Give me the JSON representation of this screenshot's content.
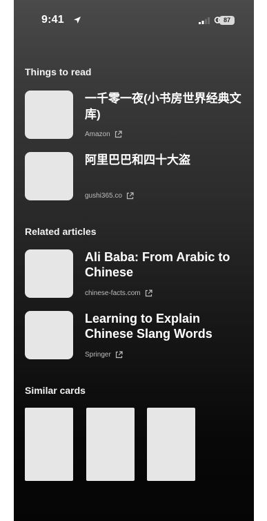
{
  "status_bar": {
    "time": "9:41",
    "battery": "87"
  },
  "sections": {
    "things_to_read": {
      "title": "Things to read",
      "items": [
        {
          "title": "一千零一夜(小书房世界经典文库)",
          "source": "Amazon"
        },
        {
          "title": "阿里巴巴和四十大盗",
          "source": "gushi365.co"
        }
      ]
    },
    "related_articles": {
      "title": "Related articles",
      "items": [
        {
          "title": "Ali Baba: From Arabic to Chinese",
          "source": "chinese-facts.com"
        },
        {
          "title": "Learning to Explain Chinese Slang Words",
          "source": "Springer"
        }
      ]
    },
    "similar_cards": {
      "title": "Similar cards"
    }
  },
  "icons": {
    "location": "location-arrow-icon",
    "signal": "signal-bars-icon",
    "link": "link-icon",
    "external": "external-link-icon"
  }
}
